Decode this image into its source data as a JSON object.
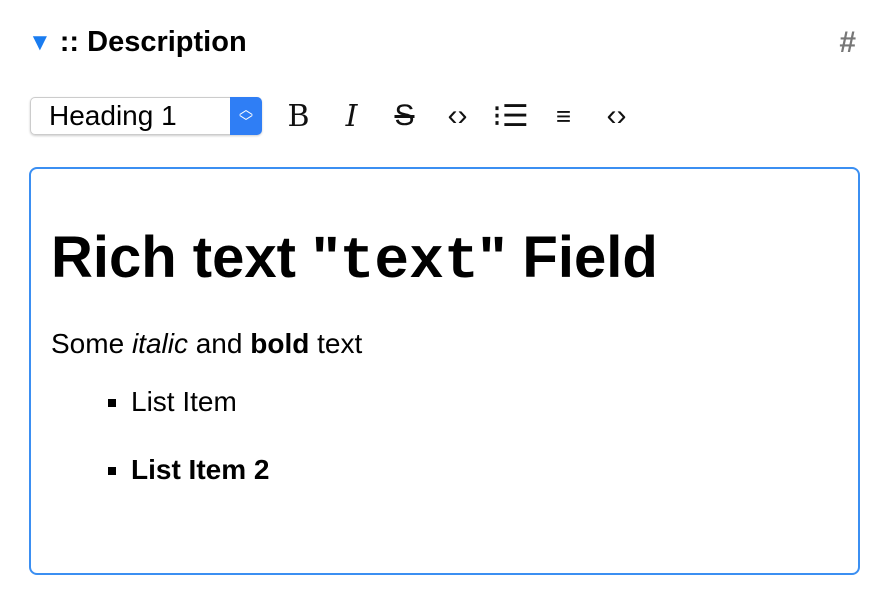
{
  "section": {
    "title": ":: Description",
    "toggle_icon": "triangle-down-icon",
    "hash": "#"
  },
  "toolbar": {
    "block_format": "Heading 1",
    "buttons": [
      {
        "name": "bold",
        "glyph": "B"
      },
      {
        "name": "italic",
        "glyph": "I"
      },
      {
        "name": "strikethrough",
        "glyph": "S"
      },
      {
        "name": "code",
        "glyph": "<>"
      },
      {
        "name": "bullet-list",
        "glyph": "☰"
      },
      {
        "name": "numbered-list",
        "glyph": "☰"
      },
      {
        "name": "code-block",
        "glyph": "<>"
      }
    ]
  },
  "editor": {
    "h1_pre": "Rich text \"",
    "h1_code": "text",
    "h1_post": "\" Field",
    "p_1": "Some ",
    "p_italic": "italic",
    "p_2": " and ",
    "p_bold": "bold",
    "p_3": " text",
    "list": [
      "List Item",
      "List Item 2"
    ]
  },
  "colors": {
    "accent": "#1a7cf0"
  }
}
